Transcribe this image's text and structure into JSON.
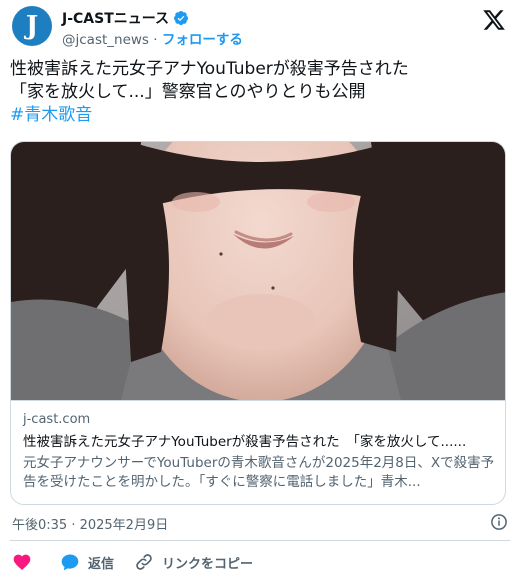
{
  "account": {
    "name": "J-CASTニュース",
    "handle": "@jcast_news",
    "separator": "·",
    "follow_label": "フォローする",
    "avatar_letter": "J"
  },
  "tweet": {
    "line1": "性被害訴えた元女子アナYouTuberが殺害予告された",
    "line2": "「家を放火して...」警察官とのやりとりも公開",
    "hashtag": "#青木歌音"
  },
  "card": {
    "domain": "j-cast.com",
    "title": "性被害訴えた元女子アナYouTuberが殺害予告された　「家を放火して......",
    "description": "元女子アナウンサーでYouTuberの青木歌音さんが2025年2月8日、Xで殺害予告を受けたことを明かした。「すぐに警察に電話しました」青木..."
  },
  "meta": {
    "timestamp": "午後0:35 · 2025年2月9日"
  },
  "actions": {
    "reply_label": "返信",
    "copy_link_label": "リンクをコピー"
  },
  "colors": {
    "accent": "#1d9bf0",
    "like": "#f91880",
    "avatar_bg": "#1d7fbf"
  },
  "icons": [
    "verified-badge-icon",
    "x-logo-icon",
    "info-icon",
    "heart-icon",
    "reply-bubble-icon",
    "link-icon"
  ]
}
